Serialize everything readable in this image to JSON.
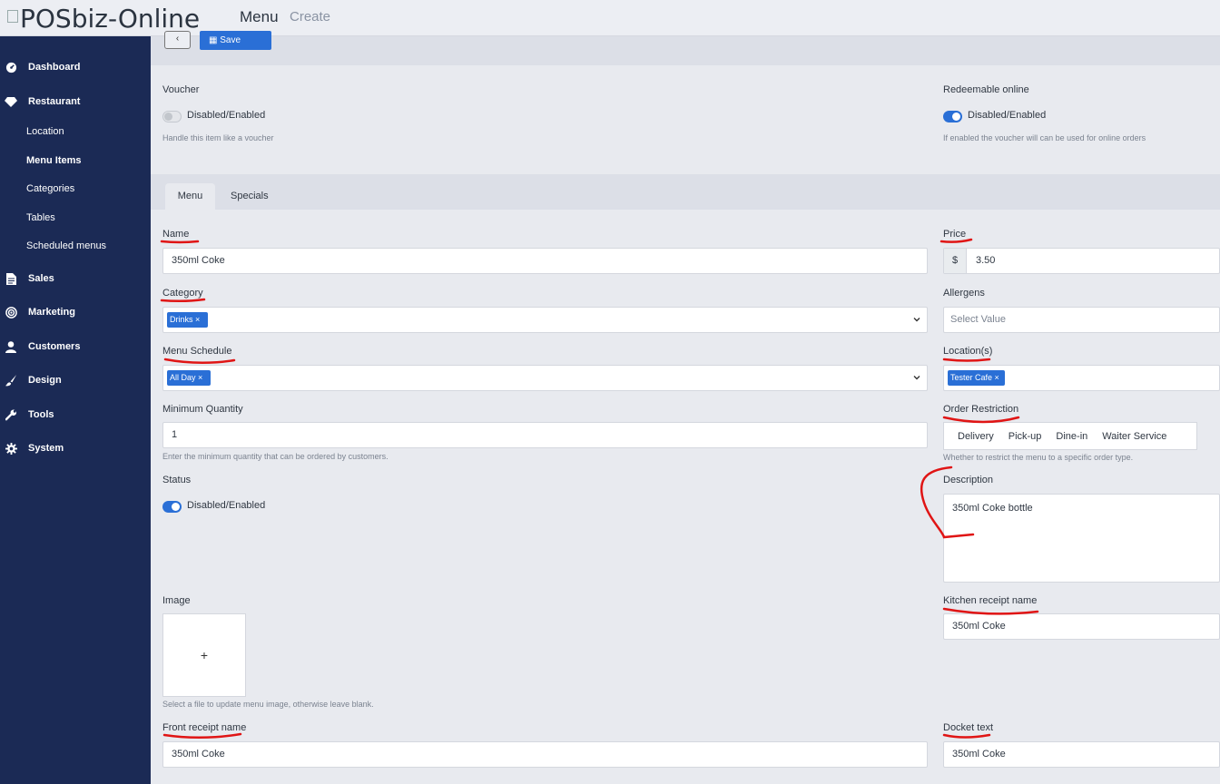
{
  "header": {
    "logo_text": "POSbiz-Online",
    "title": "Menu",
    "subtitle": "Create"
  },
  "sidebar": {
    "items": [
      {
        "label": "Dashboard",
        "icon": "dashboard-icon"
      },
      {
        "label": "Restaurant",
        "icon": "diamond-icon"
      },
      {
        "label": "Sales",
        "icon": "document-icon"
      },
      {
        "label": "Marketing",
        "icon": "target-icon"
      },
      {
        "label": "Customers",
        "icon": "user-icon"
      },
      {
        "label": "Design",
        "icon": "brush-icon"
      },
      {
        "label": "Tools",
        "icon": "wrench-icon"
      },
      {
        "label": "System",
        "icon": "gear-icon"
      }
    ],
    "restaurant_sub": [
      "Location",
      "Menu Items",
      "Categories",
      "Tables",
      "Scheduled menus"
    ],
    "active_sub": "Menu Items"
  },
  "toolbar": {
    "back_label": "‹",
    "save_label": "Save"
  },
  "voucher": {
    "label": "Voucher",
    "toggle_label": "Disabled/Enabled",
    "enabled": false,
    "help": "Handle this item like a voucher"
  },
  "redeemable": {
    "label": "Redeemable online",
    "toggle_label": "Disabled/Enabled",
    "enabled": true,
    "help": "If enabled the voucher will can be used for online orders"
  },
  "tabs": [
    {
      "label": "Menu",
      "active": true
    },
    {
      "label": "Specials",
      "active": false
    }
  ],
  "form": {
    "name": {
      "label": "Name",
      "value": "350ml Coke"
    },
    "price": {
      "label": "Price",
      "currency": "$",
      "value": "3.50"
    },
    "category": {
      "label": "Category",
      "tag": "Drinks"
    },
    "allergens": {
      "label": "Allergens",
      "placeholder": "Select Value"
    },
    "menu_schedule": {
      "label": "Menu Schedule",
      "tag": "All Day"
    },
    "locations": {
      "label": "Location(s)",
      "tag": "Tester Cafe"
    },
    "minimum_quantity": {
      "label": "Minimum Quantity",
      "value": "1",
      "help": "Enter the minimum quantity that can be ordered by customers."
    },
    "order_restriction": {
      "label": "Order Restriction",
      "options": [
        "Delivery",
        "Pick-up",
        "Dine-in",
        "Waiter Service"
      ],
      "help": "Whether to restrict the menu to a specific order type."
    },
    "status": {
      "label": "Status",
      "toggle_label": "Disabled/Enabled",
      "enabled": true
    },
    "description": {
      "label": "Description",
      "value": "350ml Coke bottle"
    },
    "image": {
      "label": "Image",
      "add_symbol": "+",
      "help": "Select a file to update menu image, otherwise leave blank."
    },
    "kitchen_receipt_name": {
      "label": "Kitchen receipt name",
      "value": "350ml Coke"
    },
    "front_receipt_name": {
      "label": "Front receipt name",
      "value": "350ml Coke"
    },
    "docket_text": {
      "label": "Docket text",
      "value": "350ml Coke"
    }
  },
  "colors": {
    "sidebar_bg": "#1b2a55",
    "accent": "#2a6fd6",
    "annotation_red": "#e01515"
  }
}
